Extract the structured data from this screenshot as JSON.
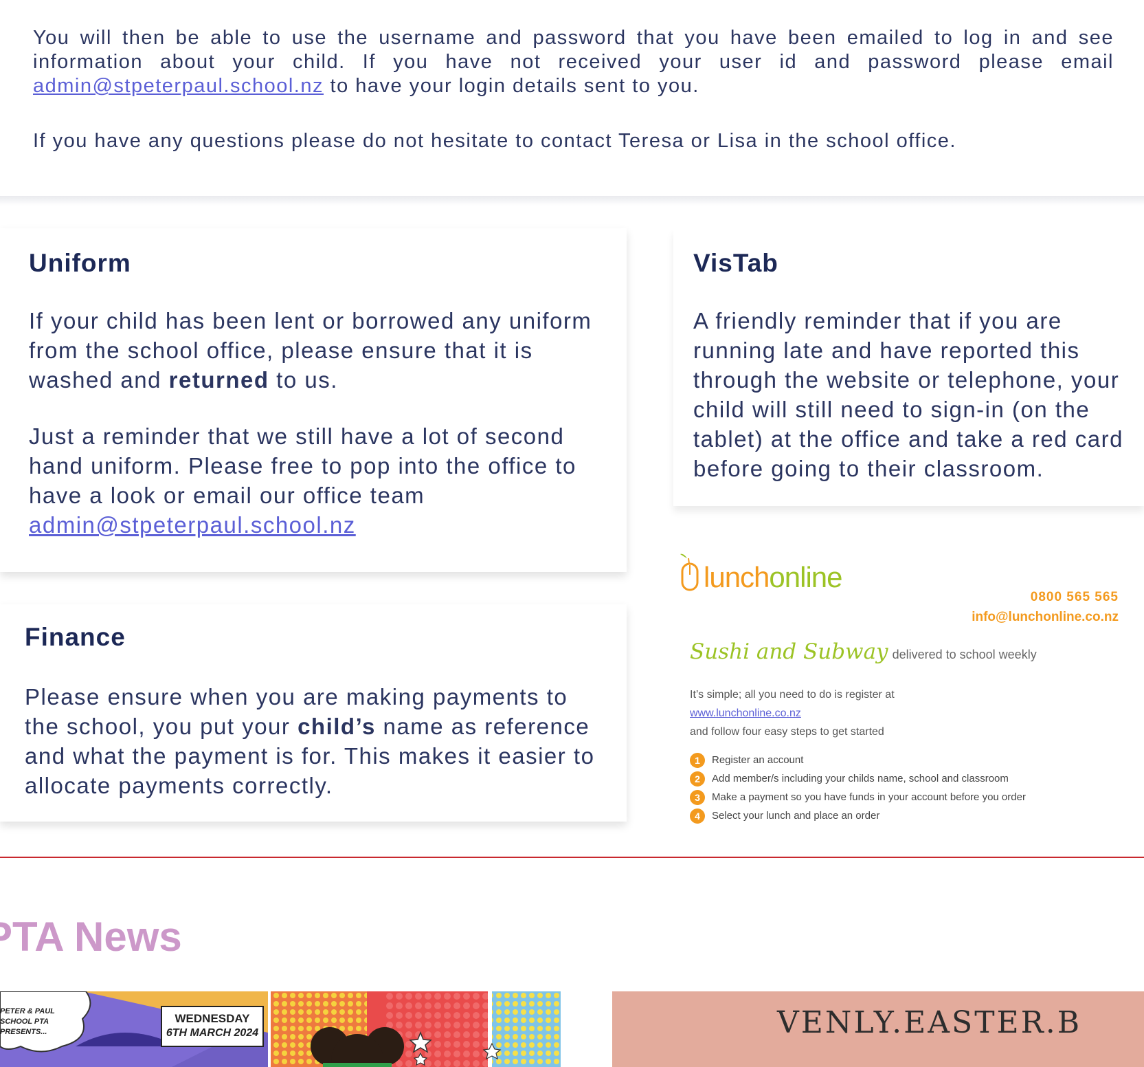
{
  "intro": {
    "p1_before": "You will then be able to use the username and password that you have been emailed to log in and see information about your child. If you have not received your user id and password please email",
    "p1_link": "admin@stpeterpaul.school.nz",
    "p1_after": " to have your login details sent to you.",
    "p2": "If you have any questions please do not hesitate to contact Teresa or Lisa in the school office."
  },
  "uniform": {
    "title": "Uniform",
    "p1_before": "If your child has been lent or borrowed any uniform from the school office, please ensure that it is washed and ",
    "p1_bold": "returned",
    "p1_after": " to us.",
    "p2": "Just a reminder that we still have a lot of second hand uniform. Please free to pop into the office to have a look or email our office team",
    "p2_link": "admin@stpeterpaul.school.nz"
  },
  "finance": {
    "title": "Finance",
    "p1_before": "Please ensure when you are making payments to the school, you put your ",
    "p1_bold": "child’s",
    "p1_after": " name as reference and what the payment is for. This makes it easier to allocate payments correctly."
  },
  "vistab": {
    "title": "VisTab",
    "p1": "A friendly reminder that if you are running late and have reported this through the website or telephone, your child will still need to sign-in (on the tablet) at the office and take a red card before going to their classroom."
  },
  "lunchonline": {
    "logo_part1": "lunch",
    "logo_part2": "online",
    "phone": "0800  565  565",
    "email": "info@lunchonline.co.nz",
    "headline": "Sushi and Subway",
    "headline_rest": "delivered to school weekly",
    "line1": "It’s simple; all you need to do is register at",
    "link": "www.lunchonline.co.nz",
    "line2": "and follow four easy steps to get started",
    "steps": [
      {
        "num": "1",
        "text": "Register an account"
      },
      {
        "num": "2",
        "text": "Add member/s including your childs name, school and classroom"
      },
      {
        "num": "3",
        "text": "Make a payment so you have funds in your account before you order"
      },
      {
        "num": "4",
        "text": "Select your lunch and place an order"
      }
    ],
    "colors": {
      "orange": "#f39a1e",
      "green": "#9cc325"
    }
  },
  "pta": {
    "title": "PTA News",
    "poster1": {
      "corner_text": "PETER & PAUL SCHOOL PTA PRESENTS...",
      "day": "WEDNESDAY",
      "date": "6TH MARCH 2024"
    },
    "poster2": {
      "arc_text": "VENLY.EASTER.B"
    }
  },
  "colors": {
    "navy": "#1c2856",
    "link": "#5b5fd6",
    "divider": "#c8282e",
    "pta_pink": "#cc98c9",
    "poster2_bg": "#e3ab9c"
  }
}
